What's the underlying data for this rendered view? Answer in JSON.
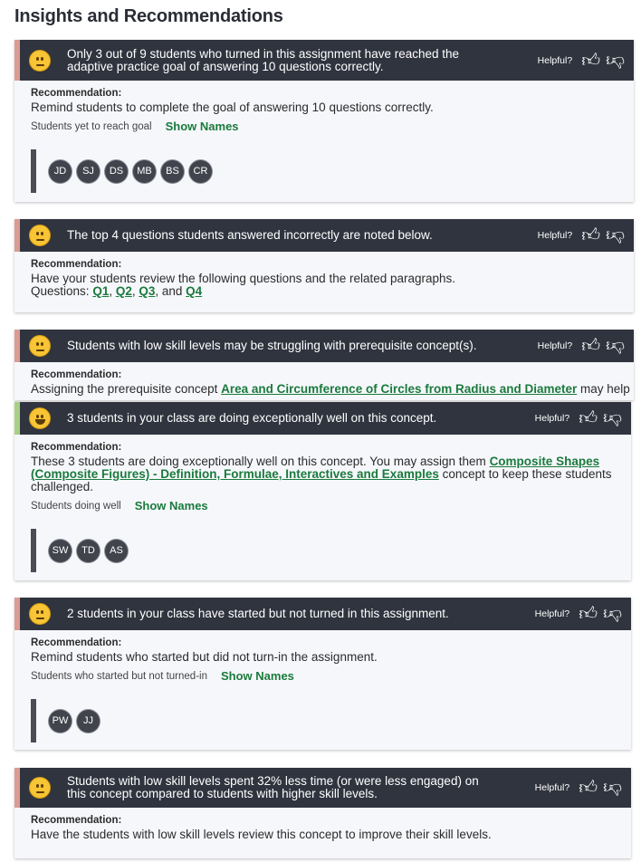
{
  "page": {
    "title": "Insights and Recommendations"
  },
  "common": {
    "helpful_label": "Helpful?",
    "recommendation_label": "Recommendation:",
    "show_names": "Show Names"
  },
  "cards": [
    {
      "mood": "neutral",
      "insight": "Only 3 out of 9 students who turned in this assignment have reached the adaptive practice goal of answering 10 questions correctly.",
      "recommendation": "Remind students to complete the goal of answering 10 questions correctly.",
      "students_label": "Students yet to reach goal",
      "students": [
        "JD",
        "SJ",
        "DS",
        "MB",
        "BS",
        "CR"
      ]
    },
    {
      "mood": "neutral",
      "insight": "The top 4 questions students answered incorrectly are noted below.",
      "recommendation": "Have your students review the following questions and the related paragraphs.",
      "questions_prefix": "Questions:",
      "questions": [
        "Q1",
        "Q2",
        "Q3",
        "Q4"
      ],
      "sep1": ", ",
      "sep2": ", ",
      "sep3": ", and "
    },
    {
      "mood": "neutral",
      "insight": "Students with low skill levels may be struggling with prerequisite concept(s).",
      "rec_before": "Assigning the prerequisite concept ",
      "rec_link": "Area and Circumference of Circles from Radius and Diameter",
      "rec_after": " may help"
    },
    {
      "mood": "happy",
      "insight": "3 students in your class are doing exceptionally well on this concept.",
      "rec_before": "These 3 students are doing exceptionally well on this concept. You may assign them ",
      "rec_link": "Composite Shapes (Composite Figures) - Definition, Formulae, Interactives and Examples",
      "rec_after": " concept to keep these students challenged.",
      "students_label": "Students doing well",
      "students": [
        "SW",
        "TD",
        "AS"
      ]
    },
    {
      "mood": "neutral",
      "insight": "2 students in your class have started but not turned in this assignment.",
      "recommendation": "Remind students who started but did not turn-in the assignment.",
      "students_label": "Students who started but not turned-in",
      "students": [
        "PW",
        "JJ"
      ]
    },
    {
      "mood": "neutral",
      "insight": "Students with low skill levels spent 32% less time (or were less engaged) on this concept compared to students with higher skill levels.",
      "recommendation": "Have the students with low skill levels review this concept to improve their skill levels."
    }
  ]
}
